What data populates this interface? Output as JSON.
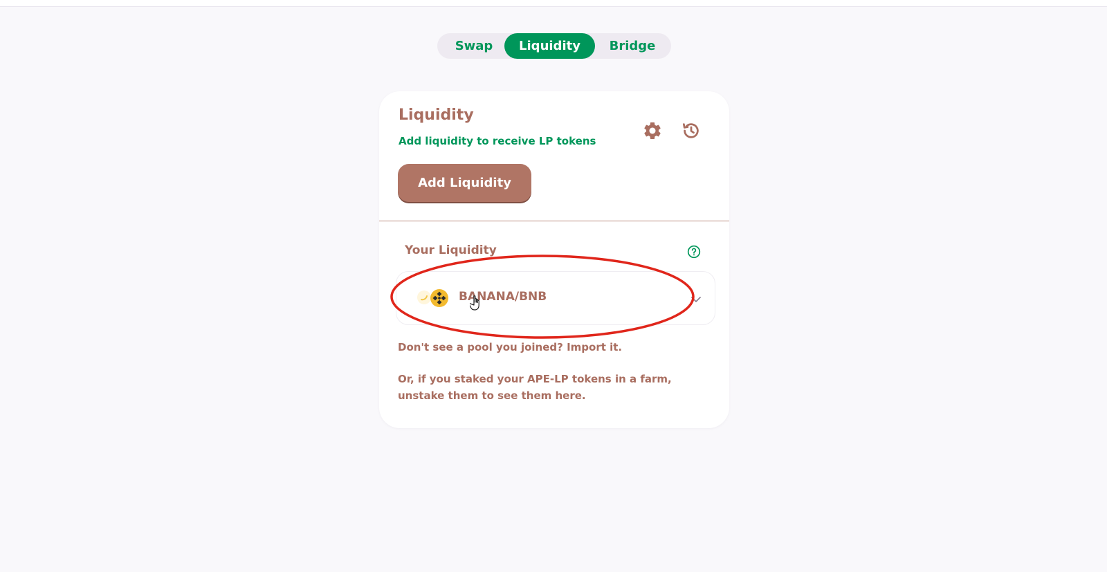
{
  "nav": {
    "tabs": [
      {
        "label": "Swap",
        "active": false
      },
      {
        "label": "Liquidity",
        "active": true
      },
      {
        "label": "Bridge",
        "active": false
      }
    ]
  },
  "card": {
    "title": "Liquidity",
    "subtitle": "Add liquidity to receive LP tokens",
    "settings_icon": "gear-icon",
    "history_icon": "history-icon",
    "add_button": "Add Liquidity"
  },
  "your_liquidity": {
    "title": "Your Liquidity",
    "help_icon": "question-circle-icon",
    "pools": [
      {
        "name": "BANANA/BNB",
        "token_icons": [
          "banana-token-icon",
          "bnb-token-icon"
        ]
      }
    ]
  },
  "hints": {
    "import_prefix": "Don't see a pool you joined? ",
    "import_link": "Import it.",
    "farm_note": "Or, if you staked your APE-LP tokens in a farm, unstake them to see them here."
  },
  "colors": {
    "brand_green": "#00965a",
    "brand_brown": "#a96e60",
    "button_brown": "#b07565",
    "annotation_red": "#e0261b",
    "bnb_yellow": "#f3ba2f"
  }
}
